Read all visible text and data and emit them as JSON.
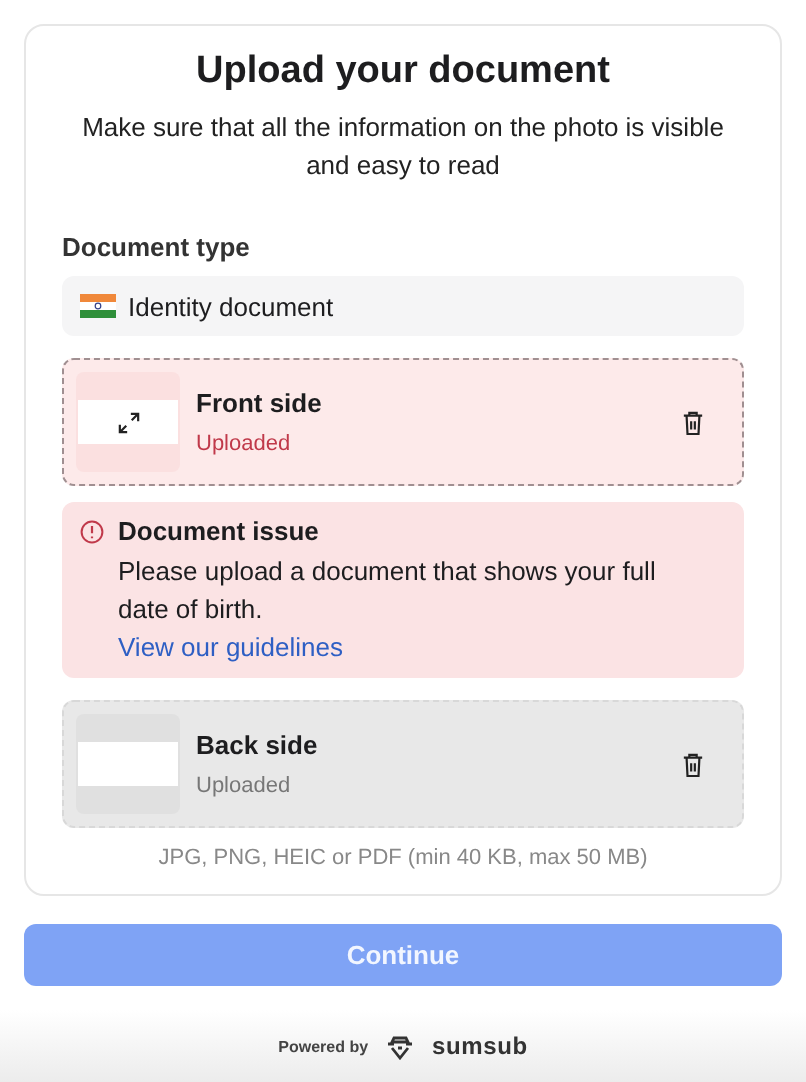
{
  "title": "Upload your document",
  "subtitle": "Make sure that all the information on the photo is visible and easy to read",
  "document_type": {
    "label": "Document type",
    "value": "Identity document"
  },
  "sides": [
    {
      "name": "Front side",
      "status": "Uploaded",
      "error": true,
      "expand": true
    },
    {
      "name": "Back side",
      "status": "Uploaded",
      "error": false,
      "expand": false
    }
  ],
  "issue": {
    "title": "Document issue",
    "message": "Please upload a document that shows your full date of birth.",
    "link": "View our guidelines"
  },
  "formats_hint": "JPG, PNG, HEIC or PDF (min 40 KB, max 50 MB)",
  "continue_button": {
    "label": "Continue",
    "disabled": true
  },
  "footer": {
    "powered_by": "Powered by",
    "brand": "sumsub"
  }
}
